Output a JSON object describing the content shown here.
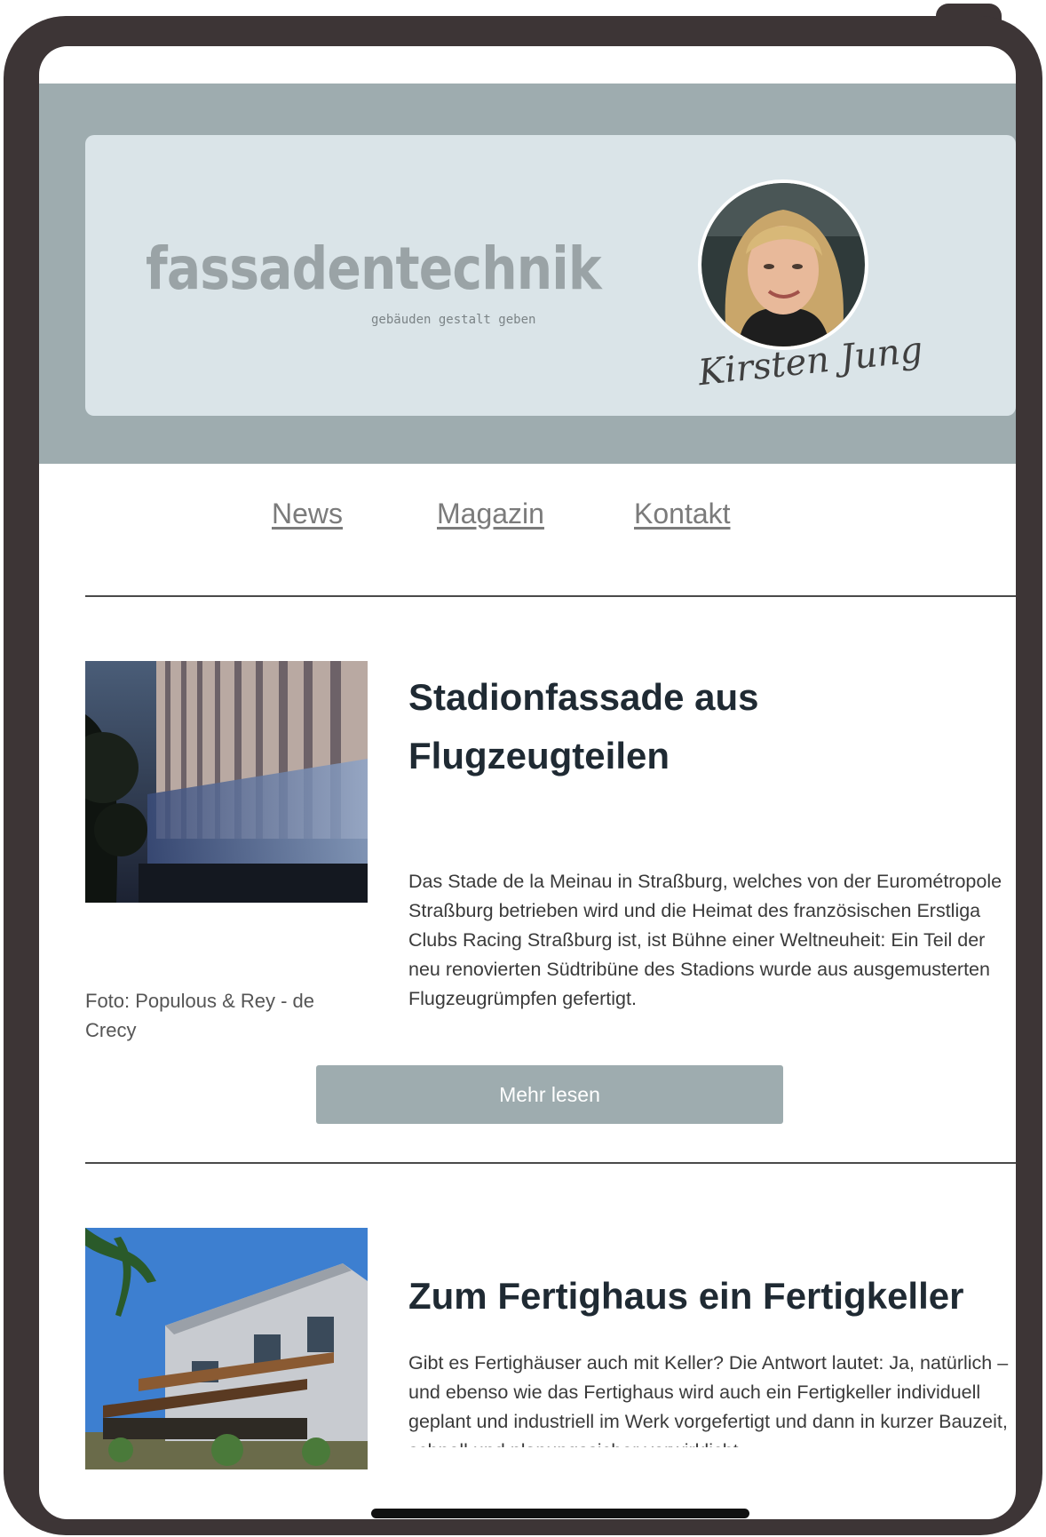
{
  "header": {
    "logo_word": "fassadentechnik",
    "logo_tagline": "gebäuden gestalt geben",
    "signature": "Kirsten Jung"
  },
  "nav": {
    "items": [
      "News",
      "Magazin",
      "Kontakt"
    ]
  },
  "articles": [
    {
      "title_line1": "Stadionfassade aus",
      "title_line2": "Flugzeugteilen",
      "text": "Das Stade de la Meinau in Straßburg, welches von der Eurométropole Straßburg betrieben wird und die Heimat des französischen Erstliga Clubs Racing Straßburg ist, ist Bühne einer Weltneuheit: Ein Teil der neu renovierten Südtribüne des Stadions wurde aus ausgemusterten Flugzeugrümpfen gefertigt.",
      "caption": "Foto: Populous & Rey - de Crecy",
      "button": "Mehr lesen"
    },
    {
      "title": "Zum Fertighaus ein Fertigkeller",
      "text": "Gibt es Fertighäuser auch mit Keller? Die Antwort lautet: Ja, natürlich – und ebenso wie das Fertighaus wird auch ein Fertigkeller individuell geplant und industriell im Werk vorgefertigt und dann in kurzer Bauzeit, schnell und planungssicher verwirklicht."
    }
  ],
  "colors": {
    "device_frame": "#3d3536",
    "header_band": "#9eacaf",
    "header_card": "#dae4e8",
    "button": "#9eacaf",
    "title": "#1f2a33"
  }
}
